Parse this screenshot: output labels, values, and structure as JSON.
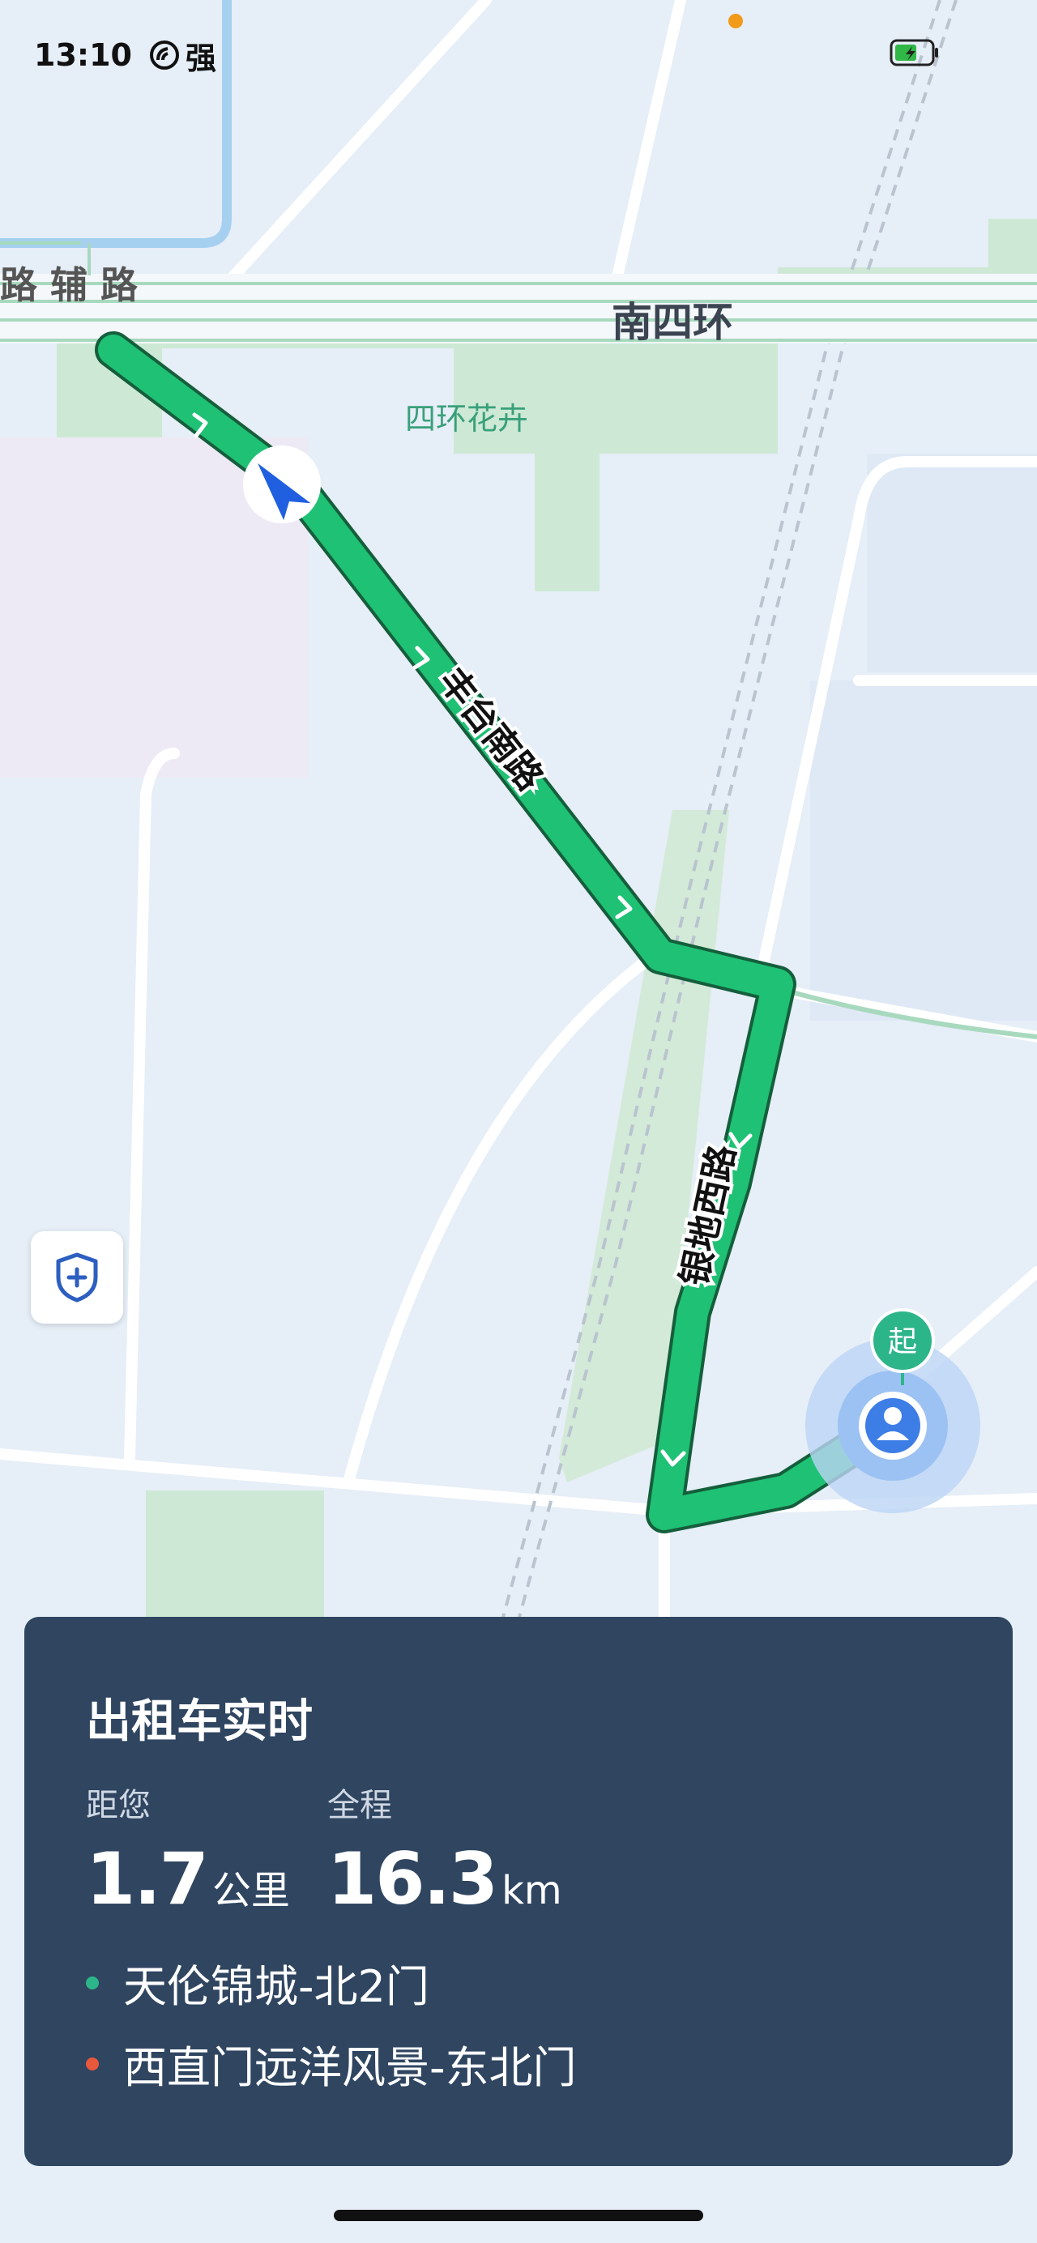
{
  "status_bar": {
    "time": "13:10",
    "signal_label": "强"
  },
  "map": {
    "road_labels": {
      "ring_road": "南四环",
      "aux_road": "路 辅 路",
      "route_road_1": "丰台南路",
      "route_road_2": "银地西路",
      "park": "四环花卉"
    },
    "start_marker": "起"
  },
  "colors": {
    "route": "#1fc174",
    "card_bg": "#2f4560",
    "start_dot": "#2db58a",
    "end_dot": "#e8583c",
    "nav_arrow": "#2060e0"
  },
  "card": {
    "title": "出租车实时",
    "distance_label": "距您",
    "distance_value": "1.7",
    "distance_unit": "公里",
    "total_label": "全程",
    "total_value": "16.3",
    "total_unit": "km",
    "origin": "天伦锦城-北2门",
    "destination": "西直门远洋风景-东北门"
  }
}
